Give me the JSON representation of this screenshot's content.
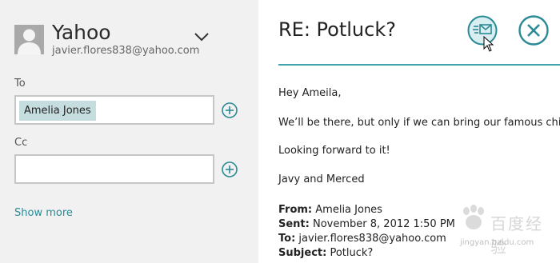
{
  "account": {
    "name": "Yahoo",
    "email": "javier.flores838@yahoo.com"
  },
  "to": {
    "label": "To",
    "recipients": [
      "Amelia Jones"
    ]
  },
  "cc": {
    "label": "Cc",
    "value": ""
  },
  "show_more": "Show more",
  "message": {
    "subject": "RE: Potluck?",
    "body": [
      "Hey Ameila,",
      "We’ll be there, but only if we can bring our famous chili!",
      "Looking forward to it!",
      "Javy and Merced"
    ],
    "quoted": {
      "from_label": "From:",
      "from": "Amelia Jones",
      "sent_label": "Sent:",
      "sent": "November 8, 2012 1:50 PM",
      "to_label": "To:",
      "to": "javier.flores838@yahoo.com",
      "subject_label": "Subject:",
      "subject": "Potluck?"
    }
  },
  "watermark": {
    "text": "百度经验",
    "url": "jingyan.baidu.com"
  },
  "colors": {
    "accent": "#2a8a96",
    "divider": "#41a4ad",
    "left_pane": "#f1f1f1",
    "chip": "#c6dde0"
  },
  "icons": {
    "avatar": "person-icon",
    "expand": "chevron-down-icon",
    "add": "plus-circle-icon",
    "send": "send-icon",
    "close": "close-icon"
  }
}
